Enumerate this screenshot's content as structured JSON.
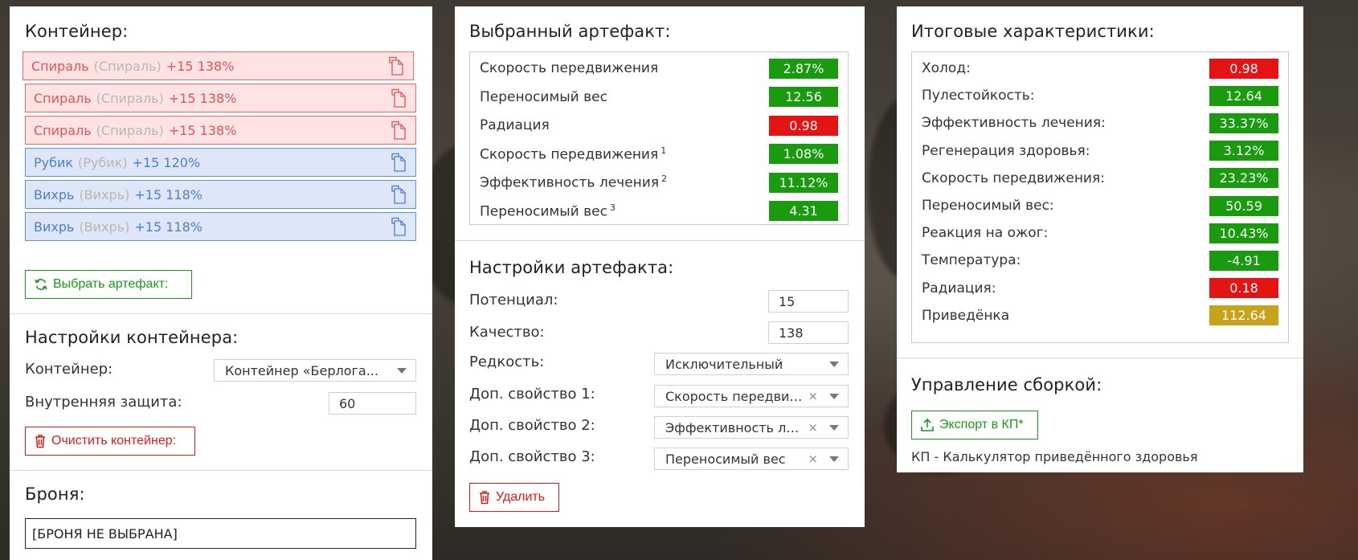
{
  "colors": {
    "green": "#199a0f",
    "red": "#e51414",
    "gold": "#c9a21b"
  },
  "container_panel": {
    "title": "Контейнер:",
    "items": [
      {
        "name": "Спираль",
        "base": "(Спираль)",
        "level": "+15 138%",
        "color": "red"
      },
      {
        "name": "Спираль",
        "base": "(Спираль)",
        "level": "+15 138%",
        "color": "red"
      },
      {
        "name": "Спираль",
        "base": "(Спираль)",
        "level": "+15 138%",
        "color": "red"
      },
      {
        "name": "Рубик",
        "base": "(Рубик)",
        "level": "+15 120%",
        "color": "blue"
      },
      {
        "name": "Вихрь",
        "base": "(Вихрь)",
        "level": "+15 118%",
        "color": "blue"
      },
      {
        "name": "Вихрь",
        "base": "(Вихрь)",
        "level": "+15 118%",
        "color": "blue"
      }
    ],
    "select_button": "Выбрать артефакт:",
    "settings_title": "Настройки контейнера:",
    "container_label": "Контейнер:",
    "container_value": "Контейнер «Берлога...",
    "protection_label": "Внутренняя защита:",
    "protection_value": "60",
    "clear_button": "Очистить контейнер:",
    "armor_title": "Броня:",
    "armor_value": "[БРОНЯ НЕ ВЫБРАНА]"
  },
  "artifact_panel": {
    "title": "Выбранный артефакт:",
    "stats": [
      {
        "name": "Скорость передвижения",
        "sup": "",
        "value": "2.87%",
        "color": "green"
      },
      {
        "name": "Переносимый вес",
        "sup": "",
        "value": "12.56",
        "color": "green"
      },
      {
        "name": "Радиация",
        "sup": "",
        "value": "0.98",
        "color": "red"
      },
      {
        "name": "Скорость передвижения",
        "sup": "1",
        "value": "1.08%",
        "color": "green"
      },
      {
        "name": "Эффективность лечения",
        "sup": "2",
        "value": "11.12%",
        "color": "green"
      },
      {
        "name": "Переносимый вес",
        "sup": "3",
        "value": "4.31",
        "color": "green"
      }
    ],
    "settings_title": "Настройки артефакта:",
    "potential_label": "Потенциал:",
    "potential_value": "15",
    "quality_label": "Качество:",
    "quality_value": "138",
    "rarity_label": "Редкость:",
    "rarity_value": "Исключительный",
    "prop1_label": "Доп. свойство 1:",
    "prop1_value": "Скорость передвижения",
    "prop2_label": "Доп. свойство 2:",
    "prop2_value": "Эффективность лечения",
    "prop3_label": "Доп. свойство 3:",
    "prop3_value": "Переносимый вес",
    "delete_button": "Удалить"
  },
  "totals_panel": {
    "title": "Итоговые характеристики:",
    "stats": [
      {
        "name": "Холод:",
        "value": "0.98",
        "color": "red"
      },
      {
        "name": "Пулестойкость:",
        "value": "12.64",
        "color": "green"
      },
      {
        "name": "Эффективность лечения:",
        "value": "33.37%",
        "color": "green"
      },
      {
        "name": "Регенерация здоровья:",
        "value": "3.12%",
        "color": "green"
      },
      {
        "name": "Скорость передвижения:",
        "value": "23.23%",
        "color": "green"
      },
      {
        "name": "Переносимый вес:",
        "value": "50.59",
        "color": "green"
      },
      {
        "name": "Реакция на ожог:",
        "value": "10.43%",
        "color": "green"
      },
      {
        "name": "Температура:",
        "value": "-4.91",
        "color": "green"
      },
      {
        "name": "Радиация:",
        "value": "0.18",
        "color": "red"
      },
      {
        "name": "Приведёнка",
        "value": "112.64",
        "color": "gold"
      }
    ],
    "build_title": "Управление сборкой:",
    "export_button": "Экспорт в КП*",
    "footnote": "КП - Калькулятор приведённого здоровья"
  }
}
